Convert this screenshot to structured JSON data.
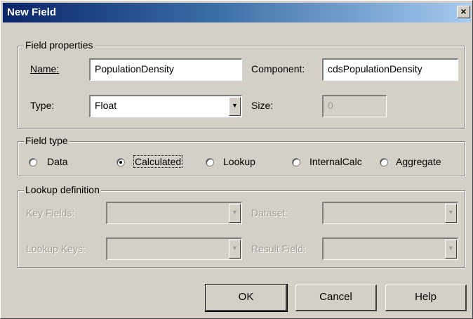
{
  "window": {
    "title": "New Field",
    "close_glyph": "×"
  },
  "field_properties": {
    "legend": "Field properties",
    "name": {
      "label": "Name:",
      "value": "PopulationDensity"
    },
    "component": {
      "label": "Component:",
      "value": "cdsPopulationDensity"
    },
    "type": {
      "label": "Type:",
      "value": "Float"
    },
    "size": {
      "label": "Size:",
      "value": "0"
    }
  },
  "field_type": {
    "legend": "Field type",
    "options": [
      {
        "label": "Data",
        "selected": false
      },
      {
        "label": "Calculated",
        "selected": true
      },
      {
        "label": "Lookup",
        "selected": false
      },
      {
        "label": "InternalCalc",
        "selected": false
      },
      {
        "label": "Aggregate",
        "selected": false
      }
    ]
  },
  "lookup_definition": {
    "legend": "Lookup definition",
    "key_fields": {
      "label": "Key Fields:",
      "value": ""
    },
    "dataset": {
      "label": "Dataset:",
      "value": ""
    },
    "lookup_keys": {
      "label": "Lookup Keys:",
      "value": ""
    },
    "result_field": {
      "label": "Result Field:",
      "value": ""
    }
  },
  "buttons": {
    "ok": "OK",
    "cancel": "Cancel",
    "help": "Help"
  },
  "icons": {
    "dropdown": "dropdown-arrow-icon",
    "close": "close-icon"
  }
}
